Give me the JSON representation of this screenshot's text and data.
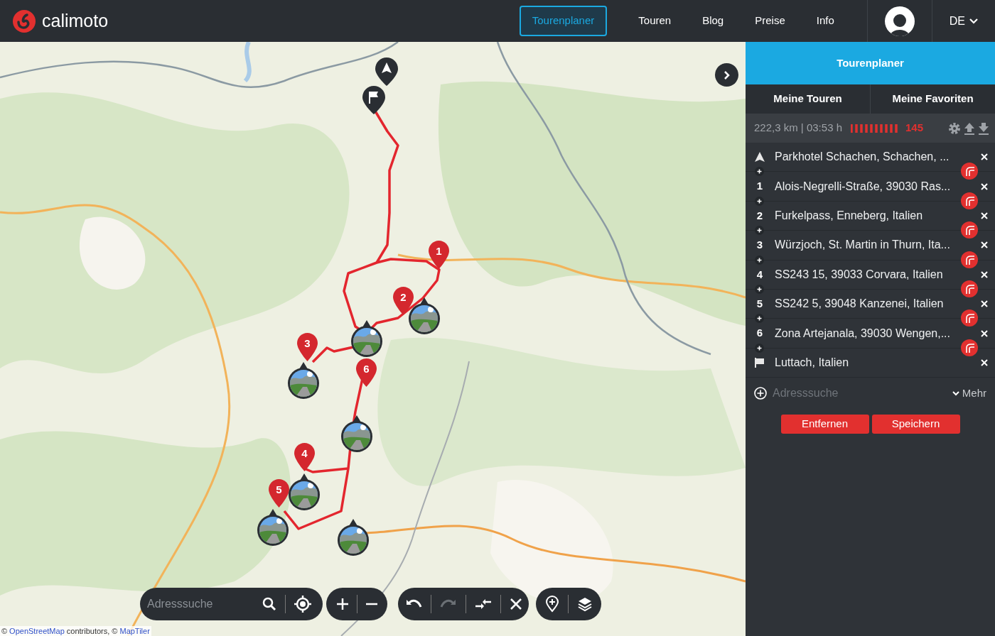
{
  "header": {
    "logo_text": "calimoto",
    "nav": [
      {
        "label": "Tourenplaner",
        "selected": true
      },
      {
        "label": "Touren",
        "selected": false
      },
      {
        "label": "Blog",
        "selected": false
      },
      {
        "label": "Preise",
        "selected": false
      },
      {
        "label": "Info",
        "selected": false
      }
    ],
    "language": "DE"
  },
  "map": {
    "pins": [
      {
        "label": "1"
      },
      {
        "label": "2"
      },
      {
        "label": "3"
      },
      {
        "label": "6"
      },
      {
        "label": "4"
      },
      {
        "label": "5"
      }
    ],
    "toolbar": {
      "placeholder": "Adresssuche",
      "redo_disabled": true
    },
    "attribution": [
      {
        "text": "©",
        "link": false
      },
      {
        "text": "OpenStreetMap",
        "link": true
      },
      {
        "text": "contributors, ©",
        "link": false
      },
      {
        "text": "MapTiler",
        "link": true
      }
    ]
  },
  "sidebar": {
    "title": "Tourenplaner",
    "tabs": [
      {
        "label": "Meine Touren",
        "selected": false
      },
      {
        "label": "Meine Favoriten",
        "selected": false
      }
    ],
    "stats": "222,3 km | 03:53 h",
    "curviness": "145",
    "waypoints": [
      {
        "kind": "start",
        "address": "Parkhotel Schachen, Schachen, ..."
      },
      {
        "kind": "number",
        "label": "1",
        "address": "Alois-Negrelli-Straße, 39030 Ras..."
      },
      {
        "kind": "number",
        "label": "2",
        "address": "Furkelpass, Enneberg, Italien"
      },
      {
        "kind": "number",
        "label": "3",
        "address": "Würzjoch, St. Martin in Thurn, Ita..."
      },
      {
        "kind": "number",
        "label": "4",
        "address": "SS243 15, 39033 Corvara, Italien"
      },
      {
        "kind": "number",
        "label": "5",
        "address": "SS242 5, 39048 Kanzenei, Italien"
      },
      {
        "kind": "number",
        "label": "6",
        "address": "Zona Artejanala, 39030 Wengen,..."
      },
      {
        "kind": "finish",
        "address": "Luttach, Italien"
      }
    ],
    "search_placeholder": "Adresssuche",
    "more": "Mehr",
    "buttons": [
      "Entfernen",
      "Speichern"
    ]
  }
}
